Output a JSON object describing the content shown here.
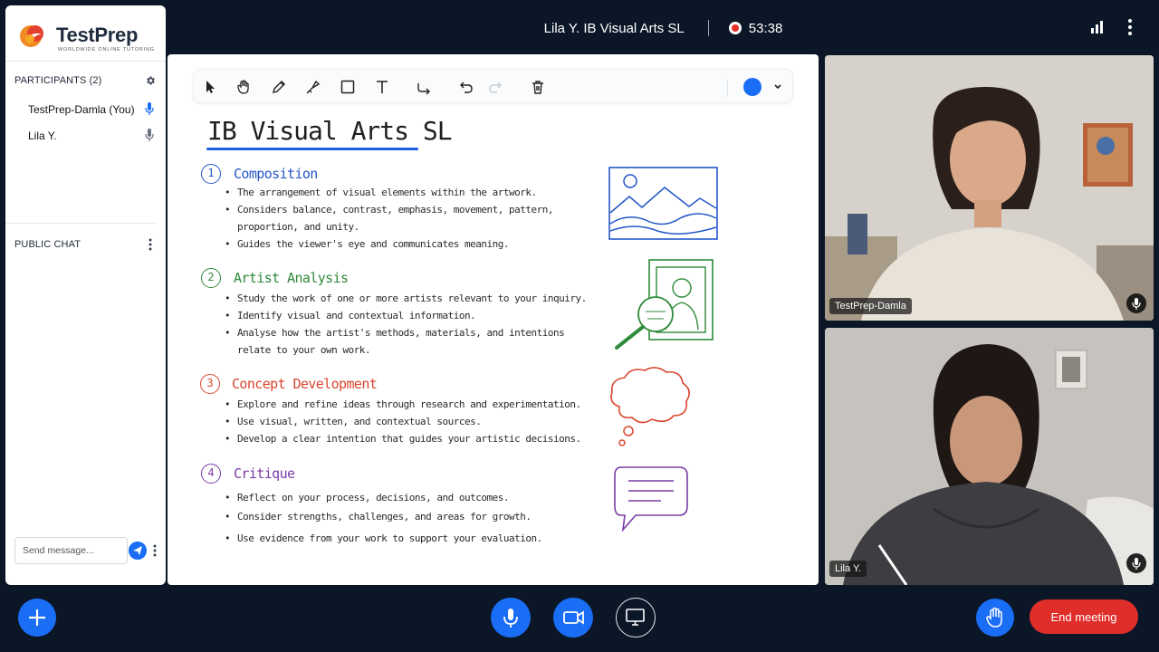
{
  "app": {
    "logo_text": "TestPrep",
    "logo_tagline": "WORLDWIDE ONLINE TUTORING",
    "brand_color": "#1a6df5"
  },
  "header": {
    "meeting_title": "Lila Y. IB Visual Arts SL",
    "timer": "53:38",
    "icons": [
      "signal-bars-icon",
      "more-vertical-icon"
    ]
  },
  "sidebar": {
    "participants_label": "PARTICIPANTS (2)",
    "participants": [
      {
        "name": "TestPrep-Damla (You)",
        "mic": "active"
      },
      {
        "name": "Lila Y.",
        "mic": "idle"
      }
    ],
    "chat_label": "PUBLIC CHAT",
    "message_placeholder": "Send message..."
  },
  "whiteboard": {
    "tools": [
      "select",
      "hand",
      "pencil",
      "marker",
      "rectangle",
      "text",
      "connector",
      "undo",
      "redo",
      "delete"
    ],
    "active_color": "#1a6df5",
    "title": "IB Visual Arts SL",
    "sections": [
      {
        "number": "1",
        "heading": "Composition",
        "color": "#2456c9",
        "bullets": [
          "The arrangement of visual elements within the artwork.",
          "Considers balance, contrast, emphasis, movement, pattern,",
          "proportion, and unity.",
          "Guides the viewer's eye and communicates meaning."
        ]
      },
      {
        "number": "2",
        "heading": "Artist Analysis",
        "color": "#2f8a3a",
        "bullets": [
          "Study the work of one or more artists relevant to your inquiry.",
          "Identify visual and contextual information.",
          "Analyse how the artist's methods, materials, and intentions",
          "relate to your own work."
        ]
      },
      {
        "number": "3",
        "heading": "Concept Development",
        "color": "#d9452e",
        "bullets": [
          "Explore and refine ideas through research and experimentation.",
          "Use visual, written, and contextual sources.",
          "Develop a clear intention that guides your artistic decisions."
        ]
      },
      {
        "number": "4",
        "heading": "Critique",
        "color": "#7a3aa6",
        "bullets": [
          "Reflect on your process, decisions, and outcomes.",
          "Consider strengths, challenges, and areas for growth.",
          "Use evidence from your work to support your evaluation."
        ]
      }
    ]
  },
  "videos": [
    {
      "name": "TestPrep-Damla"
    },
    {
      "name": "Lila Y."
    }
  ],
  "controls": {
    "end_meeting_label": "End meeting",
    "end_color": "#e02e2a"
  }
}
